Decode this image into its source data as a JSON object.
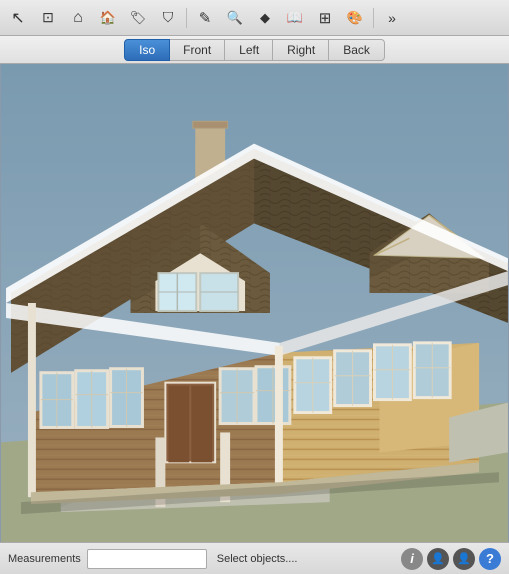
{
  "toolbar": {
    "tools": [
      {
        "name": "select",
        "icon": "cursor",
        "label": "Select"
      },
      {
        "name": "orbit",
        "icon": "box",
        "label": "Orbit"
      },
      {
        "name": "home",
        "icon": "home",
        "label": "Home"
      },
      {
        "name": "components",
        "icon": "bag",
        "label": "Components"
      },
      {
        "name": "materials",
        "icon": "tag",
        "label": "Materials"
      },
      {
        "name": "styles",
        "icon": "shield",
        "label": "Styles"
      },
      {
        "name": "pencil",
        "icon": "pencil",
        "label": "Draw"
      },
      {
        "name": "search",
        "icon": "search",
        "label": "Search"
      },
      {
        "name": "shape",
        "icon": "diamond",
        "label": "Shapes"
      },
      {
        "name": "pages",
        "icon": "book",
        "label": "Pages"
      },
      {
        "name": "layout",
        "icon": "grid",
        "label": "Layout"
      },
      {
        "name": "paint",
        "icon": "paint",
        "label": "Paint"
      },
      {
        "name": "more",
        "icon": "more",
        "label": "More"
      }
    ]
  },
  "view_tabs": {
    "tabs": [
      {
        "id": "iso",
        "label": "Iso",
        "active": true
      },
      {
        "id": "front",
        "label": "Front",
        "active": false
      },
      {
        "id": "left",
        "label": "Left",
        "active": false
      },
      {
        "id": "right",
        "label": "Right",
        "active": false
      },
      {
        "id": "back",
        "label": "Back",
        "active": false
      }
    ]
  },
  "statusbar": {
    "measurements_label": "Measurements",
    "measurements_placeholder": "",
    "status_text": "Select objects....",
    "icons": [
      {
        "name": "info",
        "symbol": "i"
      },
      {
        "name": "instructor",
        "symbol": "👤"
      },
      {
        "name": "more-info",
        "symbol": "👤"
      },
      {
        "name": "help",
        "symbol": "?"
      }
    ]
  },
  "viewport": {
    "background_color": "#8fa8b8"
  }
}
